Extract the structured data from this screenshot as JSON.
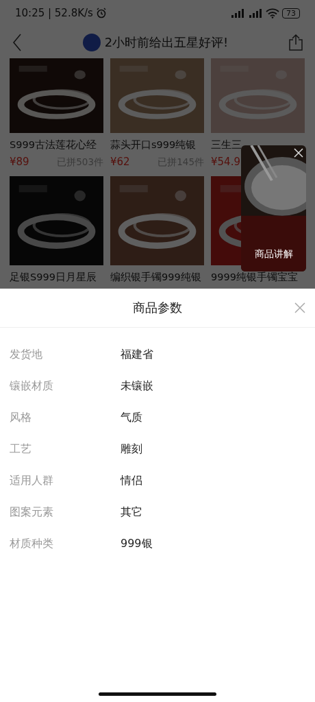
{
  "status_bar": {
    "time": "10:25 | 52.8K/s",
    "battery": "73"
  },
  "header": {
    "title": "2小时前给出五星好评!"
  },
  "products": [
    {
      "kind": "picture",
      "title": "S999古法莲花心经",
      "price": "¥89",
      "sold": "已拼503件"
    },
    {
      "kind": "picture",
      "title": "蒜头开口s999纯银",
      "price": "¥62",
      "sold": "已拼145件"
    },
    {
      "kind": "picture",
      "title": "三生三",
      "price": "¥54.9"
    },
    {
      "kind": "picture",
      "title": "足银S999日月星辰"
    },
    {
      "kind": "picture",
      "title": "编织银手镯999纯银"
    },
    {
      "kind": "picture",
      "title": "9999纯银手镯宝宝"
    }
  ],
  "video_overlay": {
    "kind": "picture",
    "label": "商品讲解"
  },
  "sheet": {
    "title": "商品参数",
    "params": [
      {
        "label": "发货地",
        "value": "福建省"
      },
      {
        "label": "镶嵌材质",
        "value": "未镶嵌"
      },
      {
        "label": "风格",
        "value": "气质"
      },
      {
        "label": "工艺",
        "value": "雕刻"
      },
      {
        "label": "适用人群",
        "value": "情侣"
      },
      {
        "label": "图案元素",
        "value": "其它"
      },
      {
        "label": "材质种类",
        "value": "999银"
      }
    ]
  }
}
